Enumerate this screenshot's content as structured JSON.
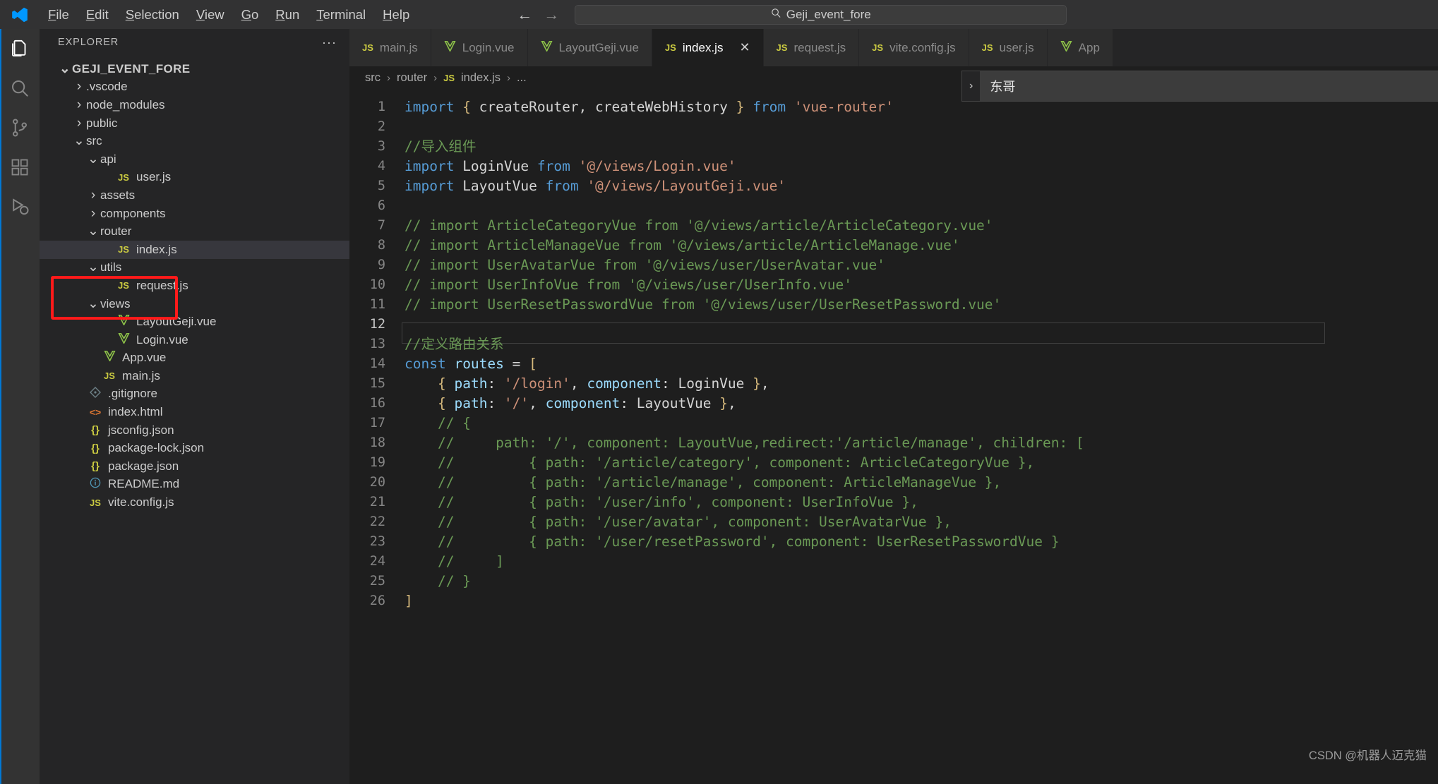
{
  "titlebar": {
    "logo_icon": "vscode-logo-icon",
    "menu": [
      {
        "label": "File",
        "mnemonic": "F"
      },
      {
        "label": "Edit",
        "mnemonic": "E"
      },
      {
        "label": "Selection",
        "mnemonic": "S"
      },
      {
        "label": "View",
        "mnemonic": "V"
      },
      {
        "label": "Go",
        "mnemonic": "G"
      },
      {
        "label": "Run",
        "mnemonic": "R"
      },
      {
        "label": "Terminal",
        "mnemonic": "T"
      },
      {
        "label": "Help",
        "mnemonic": "H"
      }
    ],
    "back_arrow": "←",
    "forward_arrow": "→",
    "search": {
      "icon": "search-icon",
      "value": "Geji_event_fore",
      "placeholder": "Search"
    }
  },
  "activitybar": {
    "items": [
      {
        "name": "explorer",
        "icon": "files-icon",
        "active": true
      },
      {
        "name": "search",
        "icon": "search-icon",
        "active": false
      },
      {
        "name": "source-control",
        "icon": "source-control-icon",
        "active": false
      },
      {
        "name": "extensions",
        "icon": "extensions-icon",
        "active": false
      },
      {
        "name": "run-and-debug",
        "icon": "run-debug-icon",
        "active": false
      }
    ]
  },
  "sidebar": {
    "title": "EXPLORER",
    "more_actions": "···",
    "tree": [
      {
        "label": "GEJI_EVENT_FORE",
        "indent": 0,
        "twisty": "down",
        "icon": "none",
        "type": "root"
      },
      {
        "label": ".vscode",
        "indent": 1,
        "twisty": "right",
        "icon": "none",
        "type": "folder"
      },
      {
        "label": "node_modules",
        "indent": 1,
        "twisty": "right",
        "icon": "none",
        "type": "folder"
      },
      {
        "label": "public",
        "indent": 1,
        "twisty": "right",
        "icon": "none",
        "type": "folder"
      },
      {
        "label": "src",
        "indent": 1,
        "twisty": "down",
        "icon": "none",
        "type": "folder"
      },
      {
        "label": "api",
        "indent": 2,
        "twisty": "down",
        "icon": "none",
        "type": "folder"
      },
      {
        "label": "user.js",
        "indent": 3,
        "twisty": "none",
        "icon": "js",
        "type": "file"
      },
      {
        "label": "assets",
        "indent": 2,
        "twisty": "right",
        "icon": "none",
        "type": "folder"
      },
      {
        "label": "components",
        "indent": 2,
        "twisty": "right",
        "icon": "none",
        "type": "folder"
      },
      {
        "label": "router",
        "indent": 2,
        "twisty": "down",
        "icon": "none",
        "type": "folder"
      },
      {
        "label": "index.js",
        "indent": 3,
        "twisty": "none",
        "icon": "js",
        "type": "file",
        "selected": true
      },
      {
        "label": "utils",
        "indent": 2,
        "twisty": "down",
        "icon": "none",
        "type": "folder"
      },
      {
        "label": "request.js",
        "indent": 3,
        "twisty": "none",
        "icon": "js",
        "type": "file"
      },
      {
        "label": "views",
        "indent": 2,
        "twisty": "down",
        "icon": "none",
        "type": "folder"
      },
      {
        "label": "LayoutGeji.vue",
        "indent": 3,
        "twisty": "none",
        "icon": "vue",
        "type": "file"
      },
      {
        "label": "Login.vue",
        "indent": 3,
        "twisty": "none",
        "icon": "vue",
        "type": "file"
      },
      {
        "label": "App.vue",
        "indent": 2,
        "twisty": "none",
        "icon": "vue",
        "type": "file"
      },
      {
        "label": "main.js",
        "indent": 2,
        "twisty": "none",
        "icon": "js",
        "type": "file"
      },
      {
        "label": ".gitignore",
        "indent": 1,
        "twisty": "none",
        "icon": "git",
        "type": "file"
      },
      {
        "label": "index.html",
        "indent": 1,
        "twisty": "none",
        "icon": "html",
        "type": "file"
      },
      {
        "label": "jsconfig.json",
        "indent": 1,
        "twisty": "none",
        "icon": "json",
        "type": "file"
      },
      {
        "label": "package-lock.json",
        "indent": 1,
        "twisty": "none",
        "icon": "json",
        "type": "file"
      },
      {
        "label": "package.json",
        "indent": 1,
        "twisty": "none",
        "icon": "json",
        "type": "file"
      },
      {
        "label": "README.md",
        "indent": 1,
        "twisty": "none",
        "icon": "md",
        "type": "file"
      },
      {
        "label": "vite.config.js",
        "indent": 1,
        "twisty": "none",
        "icon": "js",
        "type": "file"
      }
    ],
    "annotation_color": "#ff1a1a"
  },
  "editor": {
    "tabs": [
      {
        "label": "main.js",
        "icon": "js",
        "active": false,
        "closable": false
      },
      {
        "label": "Login.vue",
        "icon": "vue",
        "active": false,
        "closable": false
      },
      {
        "label": "LayoutGeji.vue",
        "icon": "vue",
        "active": false,
        "closable": false
      },
      {
        "label": "index.js",
        "icon": "js",
        "active": true,
        "closable": true,
        "close_label": "✕"
      },
      {
        "label": "request.js",
        "icon": "js",
        "active": false,
        "closable": false
      },
      {
        "label": "vite.config.js",
        "icon": "js",
        "active": false,
        "closable": false
      },
      {
        "label": "user.js",
        "icon": "js",
        "active": false,
        "closable": false
      },
      {
        "label": "App",
        "icon": "vue",
        "active": false,
        "closable": false
      }
    ],
    "breadcrumb": [
      {
        "label": "src",
        "icon": "none"
      },
      {
        "label": "router",
        "icon": "none"
      },
      {
        "label": "index.js",
        "icon": "js"
      },
      {
        "label": "...",
        "icon": "none"
      }
    ],
    "breadcrumb_separator": "›",
    "lines": [
      {
        "n": "1",
        "tokens": [
          {
            "t": "import ",
            "c": "kw"
          },
          {
            "t": "{",
            "c": "br"
          },
          {
            "t": " createRouter, createWebHistory ",
            "c": "id"
          },
          {
            "t": "}",
            "c": "br"
          },
          {
            "t": " ",
            "c": "id"
          },
          {
            "t": "from",
            "c": "kw"
          },
          {
            "t": " ",
            "c": "id"
          },
          {
            "t": "'vue-router'",
            "c": "str"
          }
        ]
      },
      {
        "n": "2",
        "tokens": []
      },
      {
        "n": "3",
        "tokens": [
          {
            "t": "//导入组件",
            "c": "cmt"
          }
        ]
      },
      {
        "n": "4",
        "tokens": [
          {
            "t": "import ",
            "c": "kw"
          },
          {
            "t": "LoginVue ",
            "c": "id"
          },
          {
            "t": "from",
            "c": "kw"
          },
          {
            "t": " ",
            "c": "id"
          },
          {
            "t": "'@/views/Login.vue'",
            "c": "str"
          }
        ]
      },
      {
        "n": "5",
        "tokens": [
          {
            "t": "import ",
            "c": "kw"
          },
          {
            "t": "LayoutVue ",
            "c": "id"
          },
          {
            "t": "from",
            "c": "kw"
          },
          {
            "t": " ",
            "c": "id"
          },
          {
            "t": "'@/views/LayoutGeji.vue'",
            "c": "str"
          }
        ]
      },
      {
        "n": "6",
        "tokens": []
      },
      {
        "n": "7",
        "tokens": [
          {
            "t": "// import ArticleCategoryVue from '@/views/article/ArticleCategory.vue'",
            "c": "cmt"
          }
        ]
      },
      {
        "n": "8",
        "tokens": [
          {
            "t": "// import ArticleManageVue from '@/views/article/ArticleManage.vue'",
            "c": "cmt"
          }
        ]
      },
      {
        "n": "9",
        "tokens": [
          {
            "t": "// import UserAvatarVue from '@/views/user/UserAvatar.vue'",
            "c": "cmt"
          }
        ]
      },
      {
        "n": "10",
        "tokens": [
          {
            "t": "// import UserInfoVue from '@/views/user/UserInfo.vue'",
            "c": "cmt"
          }
        ]
      },
      {
        "n": "11",
        "tokens": [
          {
            "t": "// import UserResetPasswordVue from '@/views/user/UserResetPassword.vue'",
            "c": "cmt"
          }
        ]
      },
      {
        "n": "12",
        "tokens": [],
        "current": true
      },
      {
        "n": "13",
        "tokens": [
          {
            "t": "//定义路由关系",
            "c": "cmt"
          }
        ]
      },
      {
        "n": "14",
        "tokens": [
          {
            "t": "const",
            "c": "kw"
          },
          {
            "t": " ",
            "c": "id"
          },
          {
            "t": "routes",
            "c": "prop"
          },
          {
            "t": " = ",
            "c": "pun"
          },
          {
            "t": "[",
            "c": "br"
          }
        ]
      },
      {
        "n": "15",
        "tokens": [
          {
            "t": "    ",
            "c": "id"
          },
          {
            "t": "{",
            "c": "br"
          },
          {
            "t": " ",
            "c": "id"
          },
          {
            "t": "path",
            "c": "prop"
          },
          {
            "t": ": ",
            "c": "pun"
          },
          {
            "t": "'/login'",
            "c": "str"
          },
          {
            "t": ", ",
            "c": "pun"
          },
          {
            "t": "component",
            "c": "prop"
          },
          {
            "t": ": ",
            "c": "pun"
          },
          {
            "t": "LoginVue ",
            "c": "id"
          },
          {
            "t": "}",
            "c": "br"
          },
          {
            "t": ",",
            "c": "pun"
          }
        ]
      },
      {
        "n": "16",
        "tokens": [
          {
            "t": "    ",
            "c": "id"
          },
          {
            "t": "{",
            "c": "br"
          },
          {
            "t": " ",
            "c": "id"
          },
          {
            "t": "path",
            "c": "prop"
          },
          {
            "t": ": ",
            "c": "pun"
          },
          {
            "t": "'/'",
            "c": "str"
          },
          {
            "t": ", ",
            "c": "pun"
          },
          {
            "t": "component",
            "c": "prop"
          },
          {
            "t": ": ",
            "c": "pun"
          },
          {
            "t": "LayoutVue ",
            "c": "id"
          },
          {
            "t": "}",
            "c": "br"
          },
          {
            "t": ",",
            "c": "pun"
          }
        ]
      },
      {
        "n": "17",
        "tokens": [
          {
            "t": "    // {",
            "c": "cmt"
          }
        ]
      },
      {
        "n": "18",
        "tokens": [
          {
            "t": "    //     path: '/', component: LayoutVue,redirect:'/article/manage', children: [",
            "c": "cmt"
          }
        ]
      },
      {
        "n": "19",
        "tokens": [
          {
            "t": "    //         { path: '/article/category', component: ArticleCategoryVue },",
            "c": "cmt"
          }
        ]
      },
      {
        "n": "20",
        "tokens": [
          {
            "t": "    //         { path: '/article/manage', component: ArticleManageVue },",
            "c": "cmt"
          }
        ]
      },
      {
        "n": "21",
        "tokens": [
          {
            "t": "    //         { path: '/user/info', component: UserInfoVue },",
            "c": "cmt"
          }
        ]
      },
      {
        "n": "22",
        "tokens": [
          {
            "t": "    //         { path: '/user/avatar', component: UserAvatarVue },",
            "c": "cmt"
          }
        ]
      },
      {
        "n": "23",
        "tokens": [
          {
            "t": "    //         { path: '/user/resetPassword', component: UserResetPasswordVue }",
            "c": "cmt"
          }
        ]
      },
      {
        "n": "24",
        "tokens": [
          {
            "t": "    //     ]",
            "c": "cmt"
          }
        ]
      },
      {
        "n": "25",
        "tokens": [
          {
            "t": "    // }",
            "c": "cmt"
          }
        ]
      },
      {
        "n": "26",
        "tokens": [
          {
            "t": "]",
            "c": "br"
          }
        ]
      }
    ]
  },
  "popup": {
    "chevron": "›",
    "value": "东哥"
  },
  "watermark": "CSDN @机器人迈克猫"
}
